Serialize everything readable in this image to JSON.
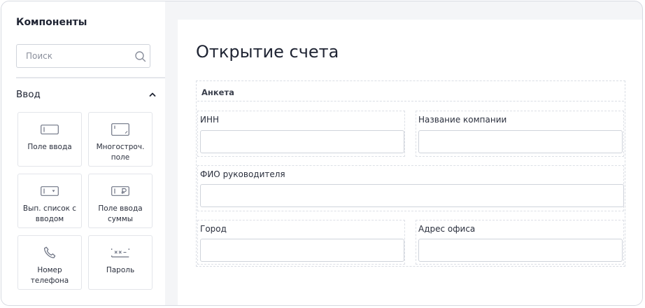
{
  "sidebar": {
    "title": "Компоненты",
    "search": {
      "placeholder": "Поиск",
      "value": ""
    },
    "section": {
      "title": "Ввод",
      "expanded": true
    },
    "tiles": [
      {
        "label": "Поле ввода",
        "icon": "text-input-icon"
      },
      {
        "label": "Многостроч. поле",
        "icon": "textarea-icon"
      },
      {
        "label": "Вып. список с вводом",
        "icon": "combobox-icon"
      },
      {
        "label": "Поле ввода суммы",
        "icon": "currency-input-icon"
      },
      {
        "label": "Номер телефона",
        "icon": "phone-icon"
      },
      {
        "label": "Пароль",
        "icon": "password-icon"
      }
    ]
  },
  "main": {
    "title": "Открытие счета",
    "form": {
      "section_title": "Анкета",
      "fields": {
        "inn": {
          "label": "ИНН",
          "value": ""
        },
        "company": {
          "label": "Название компании",
          "value": ""
        },
        "director": {
          "label": "ФИО руководителя",
          "value": ""
        },
        "city": {
          "label": "Город",
          "value": ""
        },
        "office": {
          "label": "Адрес офиса",
          "value": ""
        }
      }
    }
  },
  "colors": {
    "border": "#cfd3db",
    "dashed": "#d9dde4",
    "icon": "#6f7585",
    "text": "#1f2433",
    "canvas": "#f4f5f7"
  }
}
